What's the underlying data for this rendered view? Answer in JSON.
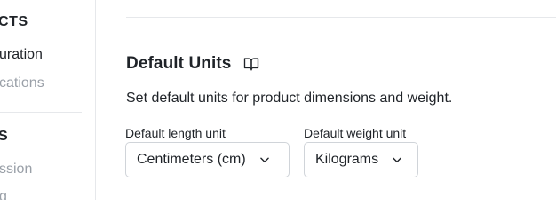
{
  "sidebar": {
    "section_products": "CTS",
    "item_configuration": "uration",
    "item_locations": "cations",
    "section_s": "S",
    "item_session": "ssion",
    "item_partial": "g"
  },
  "default_units": {
    "title": "Default Units",
    "description": "Set default units for product dimensions and weight.",
    "length": {
      "label": "Default length unit",
      "value": "Centimeters (cm)"
    },
    "weight": {
      "label": "Default weight unit",
      "value": "Kilograms"
    }
  },
  "icons": {
    "title_icon": "book-open-icon",
    "select_icon": "chevron-down-icon"
  },
  "colors": {
    "text": "#1f2328",
    "muted_text": "#9aa0a8",
    "border": "#d0d4d9",
    "divider": "#e6e8eb"
  }
}
